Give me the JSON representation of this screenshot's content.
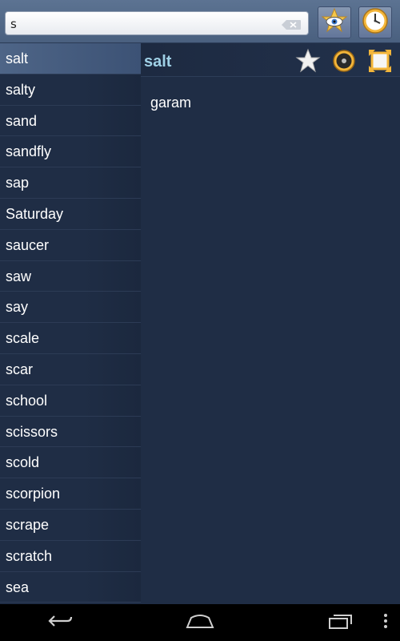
{
  "search": {
    "value": "s",
    "placeholder": ""
  },
  "toolbar": {
    "favorites_icon": "star-eye-icon",
    "history_icon": "clock-icon"
  },
  "word_list": [
    "salt",
    "salty",
    "sand",
    "sandfly",
    "sap",
    "Saturday",
    "saucer",
    "saw",
    "say",
    "scale",
    "scar",
    "school",
    "scissors",
    "scold",
    "scorpion",
    "scrape",
    "scratch",
    "sea"
  ],
  "selected_index": 0,
  "entry": {
    "headword": "salt",
    "translation": "garam"
  },
  "colors": {
    "accent": "#9fd0e6",
    "background": "#1f2d45",
    "selected": "#4e6587"
  }
}
